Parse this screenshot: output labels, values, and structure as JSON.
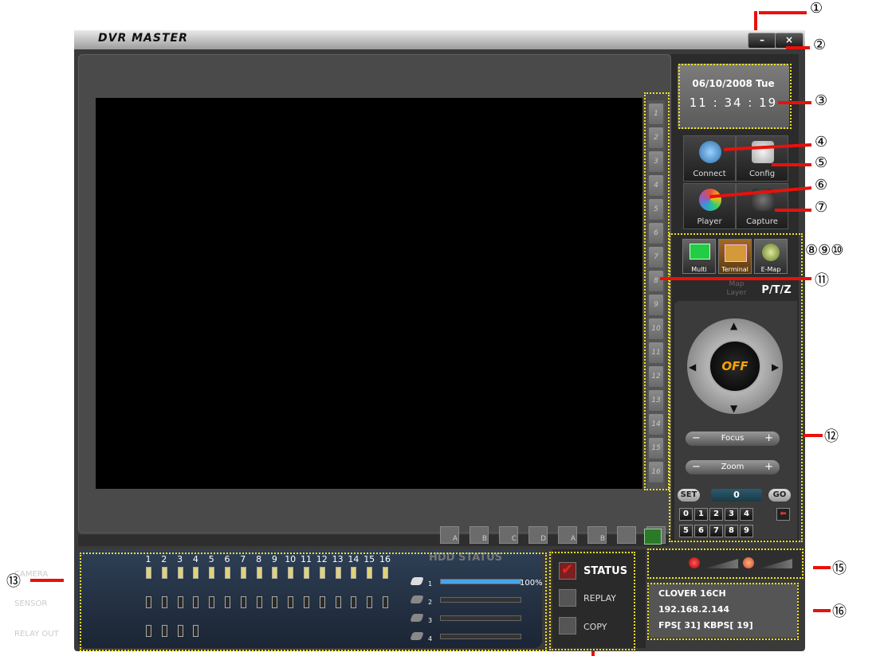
{
  "window": {
    "title": "DVR MASTER",
    "minimize_label": "–",
    "close_label": "×"
  },
  "clock": {
    "date": "06/10/2008 Tue",
    "time": "11 : 34 : 19"
  },
  "main_buttons": [
    {
      "label": "Connect",
      "icon": "connect-icon"
    },
    {
      "label": "Config",
      "icon": "config-icon"
    },
    {
      "label": "Player",
      "icon": "player-icon"
    },
    {
      "label": "Capture",
      "icon": "capture-icon"
    }
  ],
  "mode_buttons": [
    {
      "label": "Multi",
      "icon": "multi-icon"
    },
    {
      "label": "Terminal",
      "icon": "terminal-icon"
    },
    {
      "label": "E-Map",
      "icon": "emap-icon"
    }
  ],
  "tabs": {
    "map_layer": "Map Layer",
    "ptz": "P/T/Z"
  },
  "ptz": {
    "center_label": "OFF",
    "focus_label": "Focus",
    "zoom_label": "Zoom",
    "minus": "−",
    "plus": "+",
    "set_label": "SET",
    "go_label": "GO",
    "preset_value": "0",
    "keys_row1": [
      "0",
      "1",
      "2",
      "3",
      "4"
    ],
    "keys_row2": [
      "5",
      "6",
      "7",
      "8",
      "9"
    ]
  },
  "channels": [
    "1",
    "2",
    "3",
    "4",
    "5",
    "6",
    "7",
    "8",
    "9",
    "10",
    "11",
    "12",
    "13",
    "14",
    "15",
    "16"
  ],
  "layout_buttons": [
    "A",
    "B",
    "C",
    "D",
    "A",
    "B",
    "",
    ""
  ],
  "io_status": {
    "columns": [
      "1",
      "2",
      "3",
      "4",
      "5",
      "6",
      "7",
      "8",
      "9",
      "10",
      "11",
      "12",
      "13",
      "14",
      "15",
      "16"
    ],
    "camera_label": "CAMERA",
    "sensor_label": "SENSOR",
    "relay_label": "RELAY OUT",
    "camera_leds": [
      true,
      true,
      true,
      true,
      true,
      true,
      true,
      true,
      true,
      true,
      true,
      true,
      true,
      true,
      true,
      true
    ],
    "sensor_leds": [
      false,
      false,
      false,
      false,
      false,
      false,
      false,
      false,
      false,
      false,
      false,
      false,
      false,
      false,
      false,
      false
    ],
    "relay_leds": [
      false,
      false,
      false,
      false
    ]
  },
  "hdd": {
    "title": "HDD STATUS",
    "disks": [
      {
        "num": "1",
        "fill": 1.0
      },
      {
        "num": "2",
        "fill": 0
      },
      {
        "num": "3",
        "fill": 0
      },
      {
        "num": "4",
        "fill": 0
      }
    ],
    "percent_label": "100%"
  },
  "side_status": {
    "status": "STATUS",
    "replay": "REPLAY",
    "copy": "COPY"
  },
  "device_info": {
    "name": "CLOVER 16CH",
    "ip": "192.168.2.144",
    "stats": "FPS[ 31]  KBPS[ 19]"
  },
  "callouts": {
    "c1": "①",
    "c2": "②",
    "c3": "③",
    "c4": "④",
    "c5": "⑤",
    "c6": "⑥",
    "c7": "⑦",
    "c8_10": "⑧⑨⑩",
    "c11": "⑪",
    "c12": "⑫",
    "c13": "⑬",
    "c15": "⑮",
    "c16": "⑯"
  },
  "colors": {
    "annotation_line": "#e8110b",
    "annotation_box": "#f2e21c",
    "led_on": "#e2d27a",
    "hdd_fill": "#4aa3e8"
  }
}
